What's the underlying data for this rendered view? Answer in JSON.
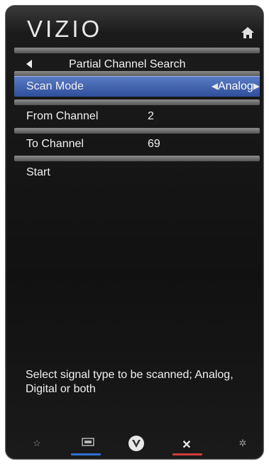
{
  "header": {
    "logo": "VIZIO"
  },
  "menu": {
    "title": "Partial Channel Search",
    "items": [
      {
        "label": "Scan Mode",
        "value": "Analog"
      },
      {
        "label": "From Channel",
        "value": "2"
      },
      {
        "label": "To Channel",
        "value": "69"
      },
      {
        "label": "Start",
        "value": ""
      }
    ]
  },
  "help": {
    "text": "Select signal type to be scanned; Analog, Digital or both"
  },
  "colors": {
    "selected": "#3f63b6",
    "nav_blue": "#2f6fd0",
    "nav_red": "#d23a3a"
  },
  "icons": {
    "home": "home-icon",
    "back": "back-arrow-icon",
    "nav": [
      "star-icon",
      "input-icon",
      "vizio-v-icon",
      "close-icon",
      "gear-icon"
    ]
  }
}
